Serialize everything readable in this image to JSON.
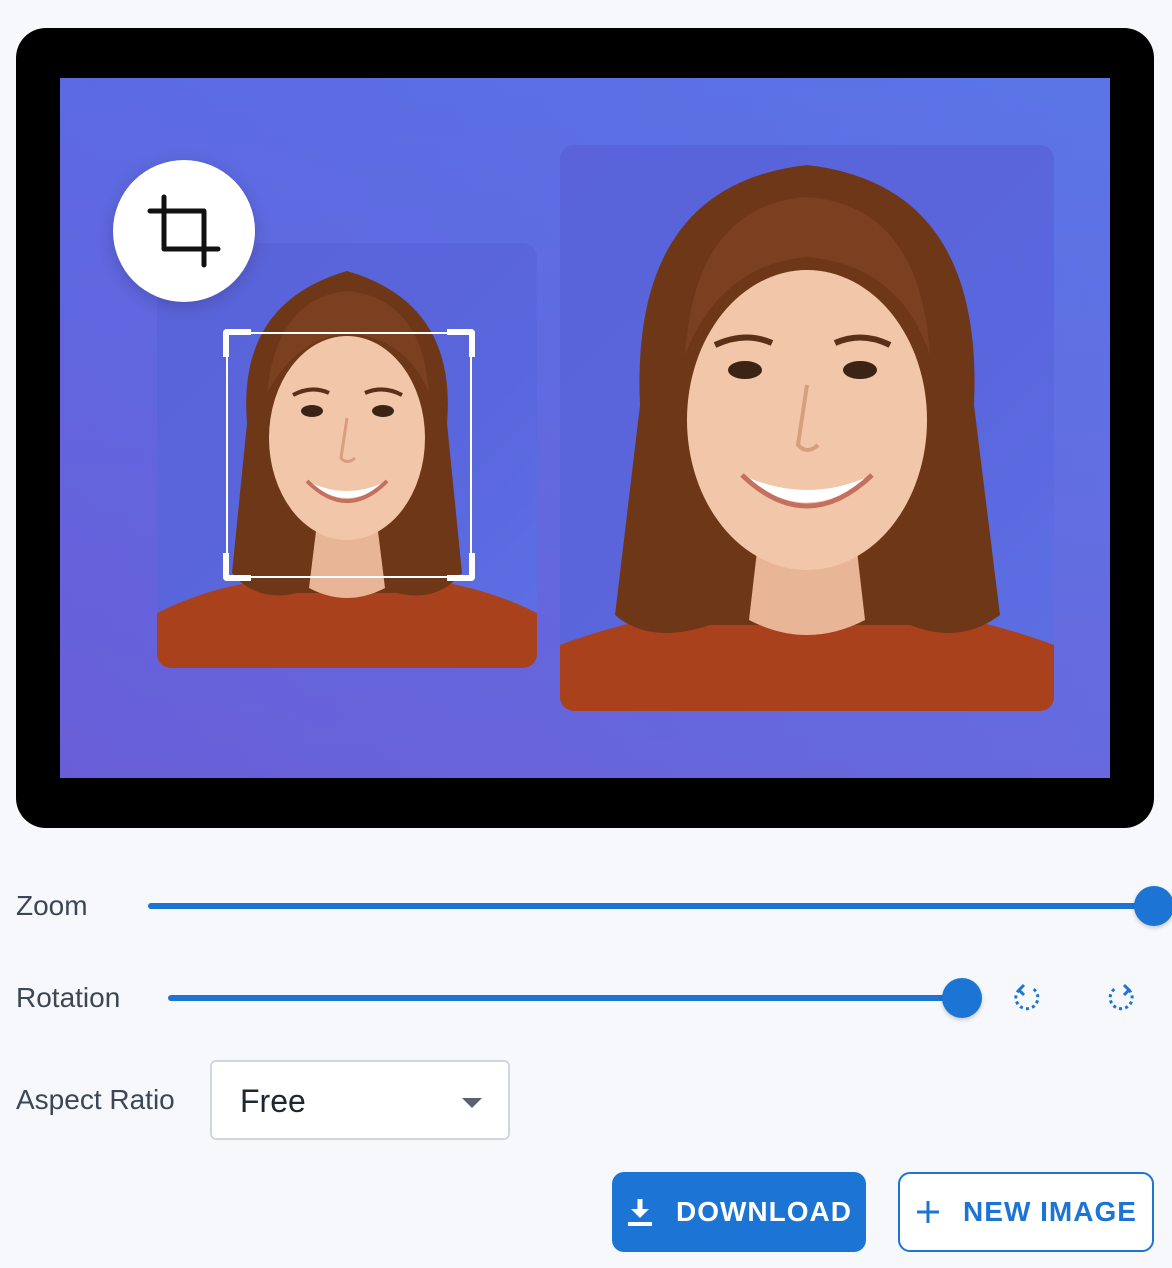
{
  "controls": {
    "zoom": {
      "label": "Zoom",
      "value_fraction": 1.0
    },
    "rotation": {
      "label": "Rotation",
      "value_fraction": 1.0
    },
    "aspect_ratio": {
      "label": "Aspect Ratio",
      "selected": "Free"
    }
  },
  "actions": {
    "download_label": "DOWNLOAD",
    "new_image_label": "NEW IMAGE"
  },
  "icons": {
    "crop": "crop-icon",
    "rotate_left": "rotate-left-icon",
    "rotate_right": "rotate-right-icon",
    "download": "download-icon",
    "add": "plus-icon",
    "dropdown": "chevron-down-icon"
  },
  "colors": {
    "accent": "#1c74d4",
    "canvas_bg": "#5f69de",
    "viewer_frame": "#000000"
  }
}
